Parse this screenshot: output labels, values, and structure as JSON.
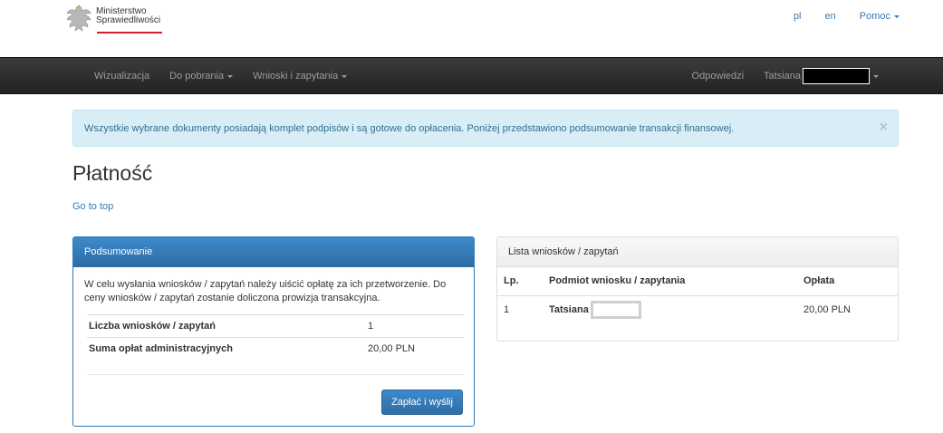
{
  "logo": {
    "line1": "Ministerstwo",
    "line2": "Sprawiedliwości"
  },
  "toplinks": {
    "pl": "pl",
    "en": "en",
    "help": "Pomoc"
  },
  "navbar": {
    "items": [
      {
        "label": "Wizualizacja"
      },
      {
        "label": "Do pobrania"
      },
      {
        "label": "Wnioski i zapytania"
      }
    ],
    "answers": "Odpowiedzi",
    "user": "Tatsiana"
  },
  "alert": {
    "text": "Wszystkie wybrane dokumenty posiadają komplet podpisów i są gotowe do opłacenia. Poniżej przedstawiono podsumowanie transakcji finansowej.",
    "close": "×"
  },
  "page": {
    "title": "Płatność",
    "go_top": "Go to top"
  },
  "summary": {
    "heading": "Podsumowanie",
    "description": "W celu wysłania wniosków / zapytań należy uiścić opłatę za ich przetworzenie. Do ceny wniosków / zapytań zostanie doliczona prowizja transakcyjna.",
    "rows": [
      {
        "label": "Liczba wniosków / zapytań",
        "value": "1"
      },
      {
        "label": "Suma opłat administracyjnych",
        "value": "20,00 PLN"
      }
    ],
    "pay_button": "Zapłać i wyślij"
  },
  "list": {
    "heading": "Lista wniosków / zapytań",
    "columns": {
      "lp": "Lp.",
      "subject": "Podmiot wniosku / zapytania",
      "fee": "Opłata"
    },
    "rows": [
      {
        "lp": "1",
        "subject": "Tatsiana",
        "fee": "20,00 PLN"
      }
    ]
  },
  "colors": {
    "primary": "#337ab7",
    "alert_bg": "#d9edf7",
    "alert_text": "#31708f",
    "navbar": "#222222"
  }
}
